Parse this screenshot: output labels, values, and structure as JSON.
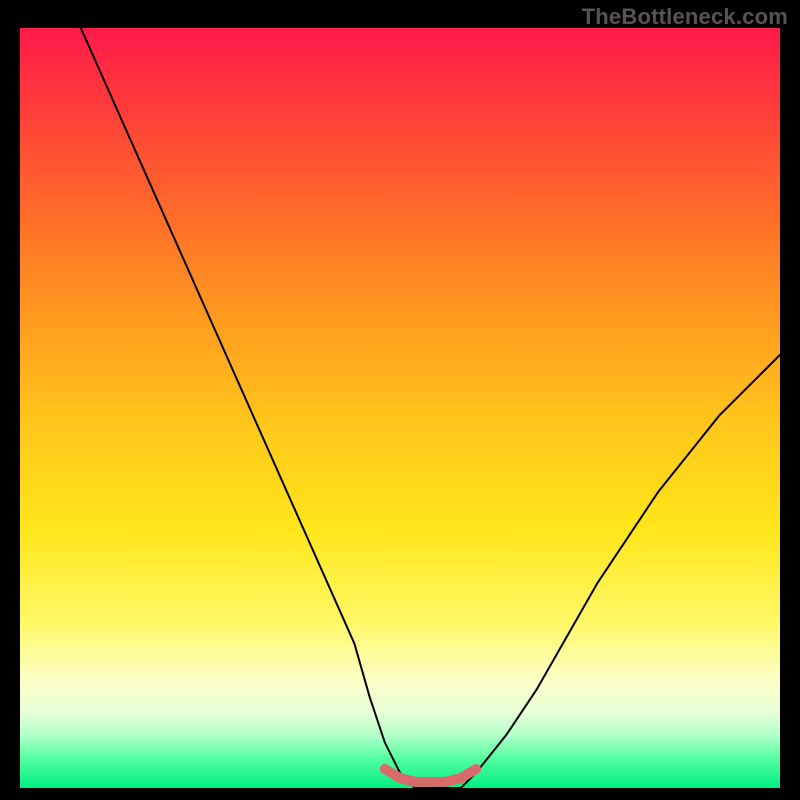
{
  "watermark": "TheBottleneck.com",
  "chart_data": {
    "type": "line",
    "title": "",
    "xlabel": "",
    "ylabel": "",
    "xlim": [
      0,
      100
    ],
    "ylim": [
      0,
      100
    ],
    "series": [
      {
        "name": "bottleneck-curve",
        "x": [
          8,
          12,
          16,
          20,
          24,
          28,
          32,
          36,
          40,
          44,
          46,
          48,
          50,
          52,
          54,
          56,
          58,
          60,
          64,
          68,
          72,
          76,
          80,
          84,
          88,
          92,
          96,
          100
        ],
        "values": [
          100,
          91,
          82,
          73,
          64,
          55,
          46,
          37,
          28,
          19,
          12,
          6,
          2,
          0,
          0,
          0,
          0,
          2,
          7,
          13,
          20,
          27,
          33,
          39,
          44,
          49,
          53,
          57
        ]
      },
      {
        "name": "optimal-zone-marker",
        "x": [
          48,
          50,
          52,
          54,
          56,
          58,
          60
        ],
        "values": [
          2.5,
          1.3,
          0.8,
          0.8,
          0.8,
          1.3,
          2.5
        ]
      }
    ],
    "gradient_stops": [
      {
        "pos": 0,
        "color": "#ff1a4a"
      },
      {
        "pos": 10,
        "color": "#ff3b3b"
      },
      {
        "pos": 24,
        "color": "#ff6a2a"
      },
      {
        "pos": 38,
        "color": "#ff9a1f"
      },
      {
        "pos": 52,
        "color": "#ffc61a"
      },
      {
        "pos": 66,
        "color": "#ffe61a"
      },
      {
        "pos": 78,
        "color": "#fff865"
      },
      {
        "pos": 86,
        "color": "#fcffc8"
      },
      {
        "pos": 90,
        "color": "#e8ffd8"
      },
      {
        "pos": 93,
        "color": "#b3ffca"
      },
      {
        "pos": 96,
        "color": "#57ff9f"
      },
      {
        "pos": 100,
        "color": "#00ef85"
      }
    ],
    "marker_color": "#d96a6a",
    "curve_color": "#000000"
  }
}
